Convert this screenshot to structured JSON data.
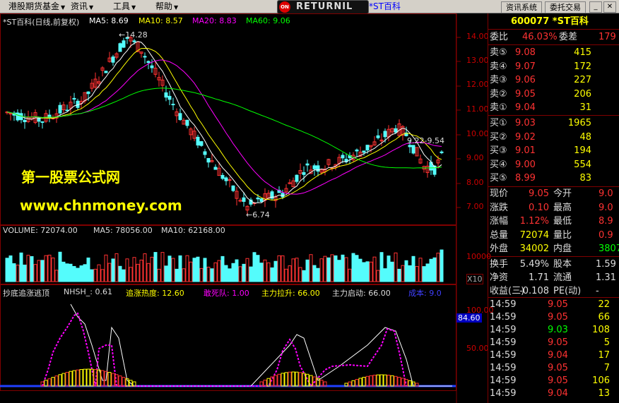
{
  "menu": {
    "items": [
      "港股期货基金",
      "资讯",
      "工具",
      "帮助"
    ],
    "returnil": "RETURNIL",
    "returnil_logo": "ON",
    "title_stock": "*ST百科",
    "btn_news": "资讯系统",
    "btn_trade": "委托交易",
    "win_min": "_",
    "win_close": "✕"
  },
  "chart": {
    "kline_header": {
      "title": "*ST百科(日线,前复权)",
      "ma5": "MA5: 8.69",
      "ma10": "MA10: 8.57",
      "ma20": "MA20: 8.83",
      "ma60": "MA60: 9.06"
    },
    "price_axis": [
      "14.00",
      "13.00",
      "12.00",
      "11.00",
      "10.00",
      "9.00",
      "8.00",
      "7.00"
    ],
    "high_label": "14.28",
    "low_label": "6.74",
    "range_label": "9.22-9.54",
    "volume_header": {
      "label": "VOLUME: 72074.00",
      "ma5": "MA5: 78056.00",
      "ma10": "MA10: 62168.00"
    },
    "volume_axis": [
      "10000"
    ],
    "volume_unit": "X10",
    "indicator_header": {
      "name": "抄底追涨逃顶",
      "nhsh": "NHSH_: 0.61",
      "zzrd": "追涨热度: 12.60",
      "gsd": "敢死队: 1.00",
      "zllsh": "主力拉升: 66.00",
      "zlqd": "主力启动: 66.00",
      "cb": "成本: 9.0"
    },
    "indicator_axis": [
      "100.00",
      "50.00"
    ],
    "indicator_tag": "84.60",
    "colors": {
      "up": "#ff3232",
      "down": "#54fcfc",
      "ma5": "#ffffff",
      "ma10": "#ffff00",
      "ma20": "#ff00ff",
      "ma60": "#00ff00",
      "grid": "#800000"
    }
  },
  "watermark": {
    "line1": "第一股票公式网",
    "line2": "www.chnmoney.com"
  },
  "quote": {
    "code_name": "600077 *ST百科",
    "weibi_label": "委比",
    "weibi": "46.03%",
    "weicha_label": "委差",
    "weicha": "179",
    "sell": [
      {
        "label": "卖⑤",
        "price": "9.08",
        "vol": "415"
      },
      {
        "label": "卖④",
        "price": "9.07",
        "vol": "172"
      },
      {
        "label": "卖③",
        "price": "9.06",
        "vol": "227"
      },
      {
        "label": "卖②",
        "price": "9.05",
        "vol": "206"
      },
      {
        "label": "卖①",
        "price": "9.04",
        "vol": "31"
      }
    ],
    "buy": [
      {
        "label": "买①",
        "price": "9.03",
        "vol": "1965"
      },
      {
        "label": "买②",
        "price": "9.02",
        "vol": "48"
      },
      {
        "label": "买③",
        "price": "9.01",
        "vol": "194"
      },
      {
        "label": "买④",
        "price": "9.00",
        "vol": "554"
      },
      {
        "label": "买⑤",
        "price": "8.99",
        "vol": "83"
      }
    ],
    "stats": [
      {
        "l1": "现价",
        "v1": "9.05",
        "l2": "今开",
        "v2": "9.0"
      },
      {
        "l1": "涨跌",
        "v1": "0.10",
        "l2": "最高",
        "v2": "9.0"
      },
      {
        "l1": "涨幅",
        "v1": "1.12%",
        "l2": "最低",
        "v2": "8.9"
      },
      {
        "l1": "总量",
        "v1": "72074",
        "l2": "量比",
        "v2": "0.9"
      },
      {
        "l1": "外盘",
        "v1": "34002",
        "l2": "内盘",
        "v2": "3807"
      }
    ],
    "stats2": [
      {
        "l1": "换手",
        "v1": "5.49%",
        "l2": "股本",
        "v2": "1.59"
      },
      {
        "l1": "净资",
        "v1": "1.71",
        "l2": "流通",
        "v2": "1.31"
      },
      {
        "l1": "收益(三)",
        "v1": "-0.108",
        "l2": "PE(动)",
        "v2": "-"
      }
    ],
    "ticks": [
      {
        "t": "14:59",
        "p": "9.05",
        "v": "22"
      },
      {
        "t": "14:59",
        "p": "9.05",
        "v": "66"
      },
      {
        "t": "14:59",
        "p": "9.03",
        "v": "108"
      },
      {
        "t": "14:59",
        "p": "9.05",
        "v": "5"
      },
      {
        "t": "14:59",
        "p": "9.04",
        "v": "17"
      },
      {
        "t": "14:59",
        "p": "9.05",
        "v": "7"
      },
      {
        "t": "14:59",
        "p": "9.05",
        "v": "106"
      },
      {
        "t": "14:59",
        "p": "9.04",
        "v": "13"
      }
    ]
  }
}
